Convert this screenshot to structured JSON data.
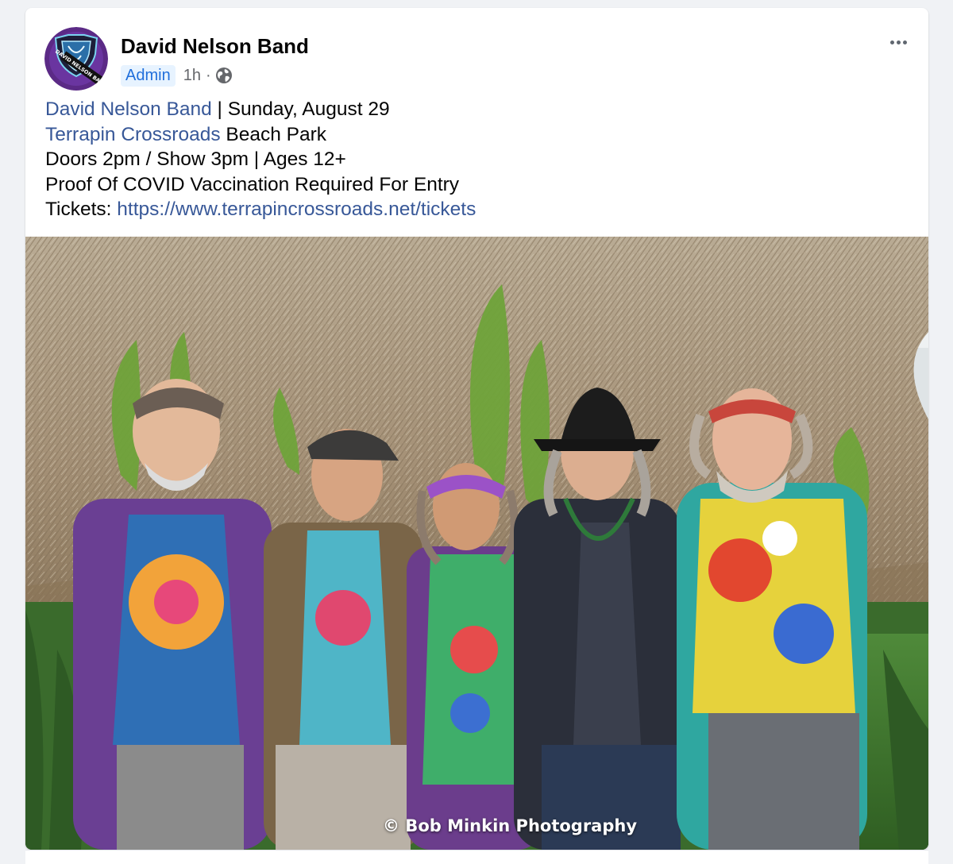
{
  "post": {
    "page_name": "David Nelson Band",
    "role_badge": "Admin",
    "time": "1h",
    "separator": "·",
    "audience_icon": "globe-icon",
    "more_icon": "more-options-icon",
    "text": {
      "line1_link": "David Nelson Band",
      "line1_rest": " | Sunday, August 29",
      "line2_link": "Terrapin Crossroads",
      "line2_rest": " Beach Park",
      "line3": "Doors 2pm / Show 3pm | Ages 12+",
      "line4": "Proof Of COVID Vaccination Required For Entry",
      "line5_label": "Tickets: ",
      "line5_link": "https://www.terrapincrossroads.net/tickets"
    },
    "photo": {
      "credit": "© Bob Minkin Photography"
    },
    "avatar_logo_text": "DAVID NELSON BAND"
  },
  "colors": {
    "link": "#385898",
    "badge_bg": "#e7f3ff",
    "badge_text": "#216fdb",
    "meta_gray": "#65676b"
  }
}
